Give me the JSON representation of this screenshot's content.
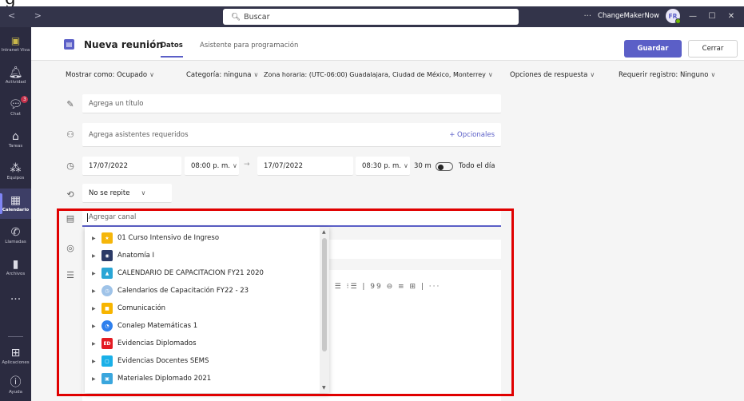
{
  "titlebar": {
    "search_placeholder": "Buscar",
    "org_name": "ChangeMakerNow",
    "avatar_initials": "FR"
  },
  "rail": {
    "items": [
      {
        "label": "Intranet Viva",
        "icon": "intranet-icon"
      },
      {
        "label": "Actividad",
        "icon": "bell-icon"
      },
      {
        "label": "Chat",
        "icon": "chat-icon",
        "badge": "3"
      },
      {
        "label": "Tareas",
        "icon": "tasks-icon"
      },
      {
        "label": "Equipos",
        "icon": "teams-icon"
      },
      {
        "label": "Calendario",
        "icon": "calendar-icon",
        "active": true
      },
      {
        "label": "Llamadas",
        "icon": "phone-icon"
      },
      {
        "label": "Archivos",
        "icon": "file-icon"
      },
      {
        "label": "...",
        "icon": "more-icon"
      },
      {
        "label": "Aplicaciones",
        "icon": "apps-icon"
      },
      {
        "label": "Ayuda",
        "icon": "help-icon"
      }
    ]
  },
  "header": {
    "title": "Nueva reunión",
    "tab_details": "Datos",
    "tab_scheduler": "Asistente para programación",
    "save_label": "Guardar",
    "close_label": "Cerrar"
  },
  "options": {
    "show_as": "Mostrar como: Ocupado",
    "category": "Categoría: ninguna",
    "timezone": "Zona horaria: (UTC-06:00) Guadalajara, Ciudad de México, Monterrey",
    "response": "Opciones de respuesta",
    "registration": "Requerir registro: Ninguno"
  },
  "form": {
    "title_placeholder": "Agrega un título",
    "attendees_placeholder": "Agrega asistentes requeridos",
    "optional_link": "+ Opcionales",
    "start_date": "17/07/2022",
    "start_time": "08:00 p. m.",
    "end_date": "17/07/2022",
    "end_time": "08:30 p. m.",
    "duration": "30 m",
    "all_day_label": "Todo el día",
    "repeat": "No se repite",
    "channel_placeholder": "Agregar canal"
  },
  "channels": [
    {
      "name": "01 Curso Intensivo de Ingreso",
      "color": "#f5b60a"
    },
    {
      "name": "Anatomía I",
      "color": "#2b3a67"
    },
    {
      "name": "CALENDARIO DE CAPACITACION FY21 2020",
      "color": "#2aa6d6"
    },
    {
      "name": "Calendarios de Capacitación FY22 - 23",
      "color": "#9fc3e8"
    },
    {
      "name": "Comunicación",
      "color": "#f7b500"
    },
    {
      "name": "Conalep Matemáticas 1",
      "color": "#2f80ed"
    },
    {
      "name": "Evidencias Diplomados",
      "color": "#e31b23"
    },
    {
      "name": "Evidencias Docentes SEMS",
      "color": "#1ab0e8"
    },
    {
      "name": "Materiales Diplomado 2021",
      "color": "#3aa6dd"
    }
  ]
}
